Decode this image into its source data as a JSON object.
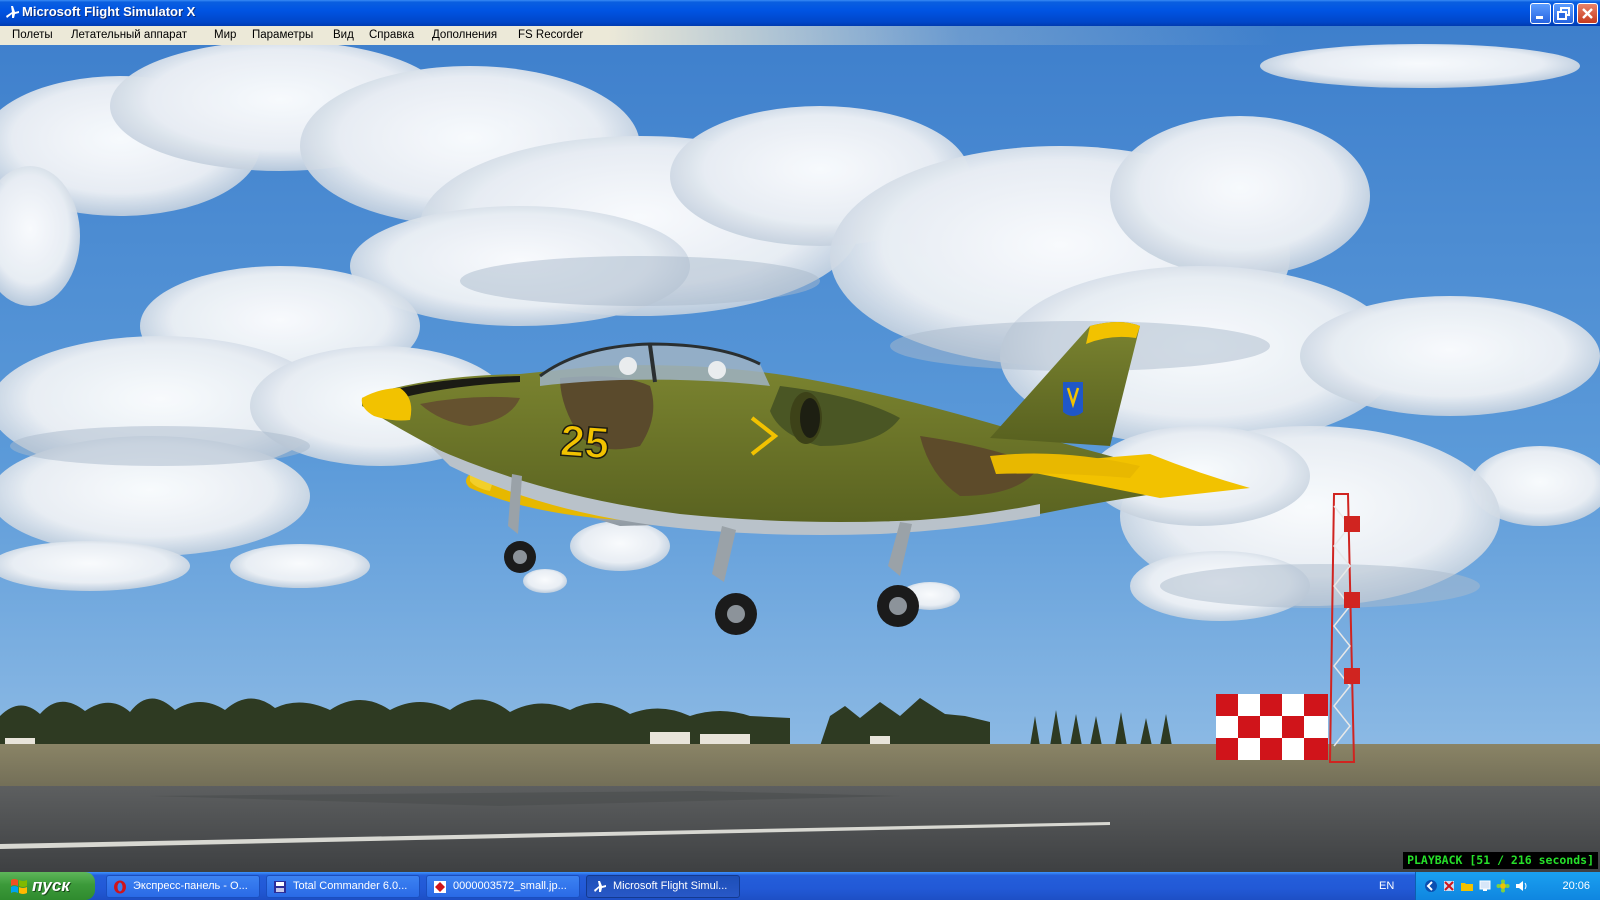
{
  "window": {
    "title": "Microsoft Flight Simulator X"
  },
  "menu": {
    "items": [
      "Полеты",
      "Летательный аппарат",
      "Мир",
      "Параметры",
      "Вид",
      "Справка",
      "Дополнения",
      "FS Recorder"
    ]
  },
  "scene": {
    "aircraft_number": "25",
    "playback_text": "PLAYBACK [51 / 216 seconds]"
  },
  "taskbar": {
    "start_label": "пуск",
    "tasks": [
      {
        "label": "Экспресс-панель - О...",
        "icon": "opera-icon"
      },
      {
        "label": "Total Commander 6.0...",
        "icon": "total-commander-icon"
      },
      {
        "label": "0000003572_small.jp...",
        "icon": "image-viewer-icon"
      },
      {
        "label": "Microsoft Flight Simul...",
        "icon": "flight-simulator-icon",
        "active": true
      }
    ],
    "language": "EN",
    "clock": "20:06"
  },
  "colors": {
    "titlebar": "#0054e3",
    "taskbar": "#245edb",
    "start_button": "#3c9a3a",
    "playback_text": "#26e02a",
    "sky": "#4f8fd6",
    "camo_green": "#6f7a2a",
    "aircraft_yellow": "#f5c400"
  }
}
